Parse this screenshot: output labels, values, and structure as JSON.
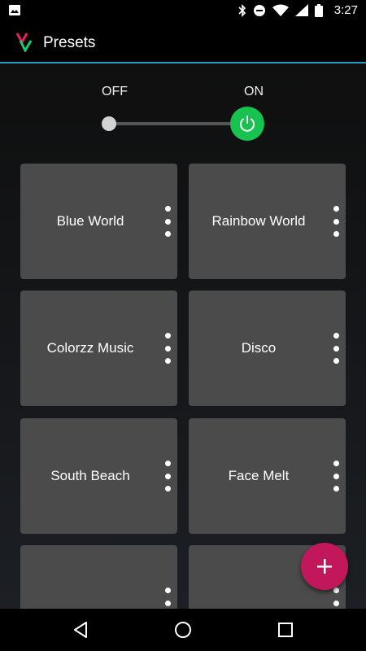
{
  "status_bar": {
    "time": "3:27",
    "icons": [
      "image-icon",
      "bluetooth-icon",
      "do-not-disturb-icon",
      "wifi-icon",
      "signal-icon",
      "battery-icon"
    ]
  },
  "app_bar": {
    "title": "Presets",
    "logo": "vv-logo",
    "accent_color": "#2a98c8"
  },
  "power": {
    "off_label": "OFF",
    "on_label": "ON",
    "state": "on",
    "on_color": "#17c24f"
  },
  "presets": [
    {
      "label": "Blue World"
    },
    {
      "label": "Rainbow World"
    },
    {
      "label": "Colorzz Music"
    },
    {
      "label": "Disco"
    },
    {
      "label": "South Beach"
    },
    {
      "label": "Face Melt"
    },
    {
      "label": ""
    },
    {
      "label": ""
    }
  ],
  "fab": {
    "icon": "plus-icon",
    "color": "#c2185b"
  },
  "nav_bar": {
    "icons": [
      "back-icon",
      "home-icon",
      "recents-icon"
    ]
  }
}
